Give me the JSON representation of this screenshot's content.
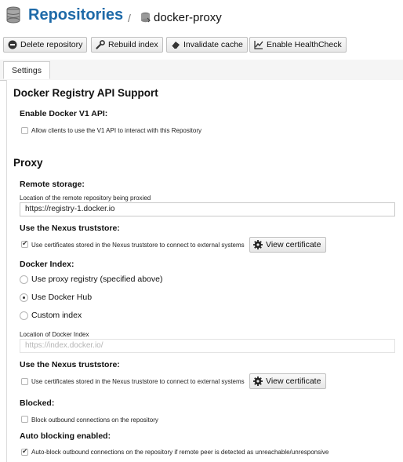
{
  "header": {
    "title": "Repositories",
    "separator": "/",
    "repo_name": "docker-proxy"
  },
  "toolbar": {
    "delete_label": "Delete repository",
    "rebuild_label": "Rebuild index",
    "invalidate_label": "Invalidate cache",
    "healthcheck_label": "Enable HealthCheck"
  },
  "tabs": [
    {
      "label": "Settings"
    }
  ],
  "registry_api": {
    "heading": "Docker Registry API Support",
    "v1_label": "Enable Docker V1 API:",
    "v1_checkbox_text": "Allow clients to use the V1 API to interact with this Repository",
    "v1_checked": false
  },
  "proxy": {
    "heading": "Proxy",
    "remote_storage_label": "Remote storage:",
    "remote_storage_help": "Location of the remote repository being proxied",
    "remote_storage_value": "https://registry-1.docker.io",
    "truststore_label": "Use the Nexus truststore:",
    "truststore_text": "Use certificates stored in the Nexus truststore to connect to external systems",
    "truststore_checked": true,
    "view_certificate_label": "View certificate",
    "docker_index_label": "Docker Index:",
    "index_options": [
      "Use proxy registry (specified above)",
      "Use Docker Hub",
      "Custom index"
    ],
    "index_selected": "Use Docker Hub",
    "index_location_help": "Location of Docker Index",
    "index_location_value": "https://index.docker.io/",
    "truststore2_label": "Use the Nexus truststore:",
    "truststore2_text": "Use certificates stored in the Nexus truststore to connect to external systems",
    "truststore2_checked": false,
    "view_certificate2_label": "View certificate",
    "blocked_label": "Blocked:",
    "blocked_text": "Block outbound connections on the repository",
    "blocked_checked": false,
    "autoblock_label": "Auto blocking enabled:",
    "autoblock_text": "Auto-block outbound connections on the repository if remote peer is detected as unreachable/unresponsive",
    "autoblock_checked": true
  },
  "colors": {
    "title": "#1e6aa8",
    "border": "#c9c9c9"
  },
  "icons": {
    "header": "database-icon",
    "repo": "database-small-icon",
    "delete": "minus-circle-icon",
    "rebuild": "wrench-icon",
    "invalidate": "eraser-icon",
    "healthcheck": "chart-line-icon",
    "certificate": "gear-icon"
  }
}
